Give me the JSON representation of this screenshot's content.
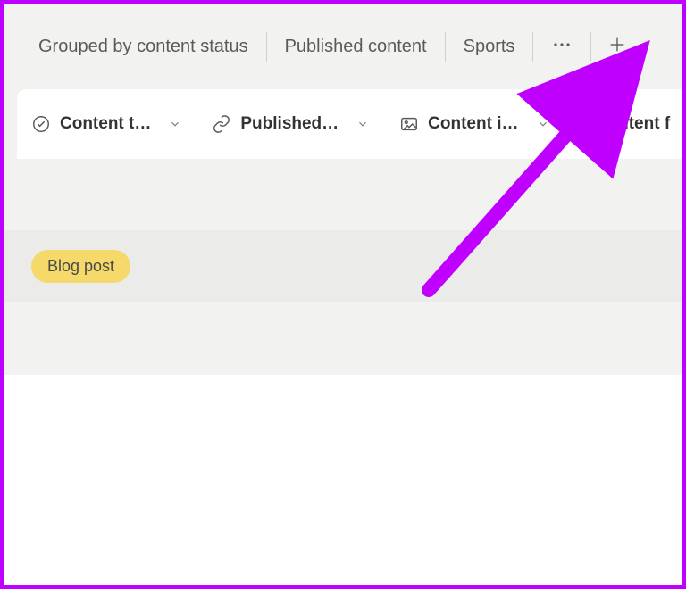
{
  "tabs": {
    "group_by": "Grouped by content status",
    "published": "Published content",
    "sports": "Sports"
  },
  "columns": {
    "content_type": "Content t…",
    "published": "Published…",
    "content_image": "Content i…",
    "content_f": "ontent f"
  },
  "rows": {
    "tag_label": "Blog post"
  },
  "colors": {
    "tag_bg": "#f5d96a",
    "annotation": "#c000ff"
  }
}
